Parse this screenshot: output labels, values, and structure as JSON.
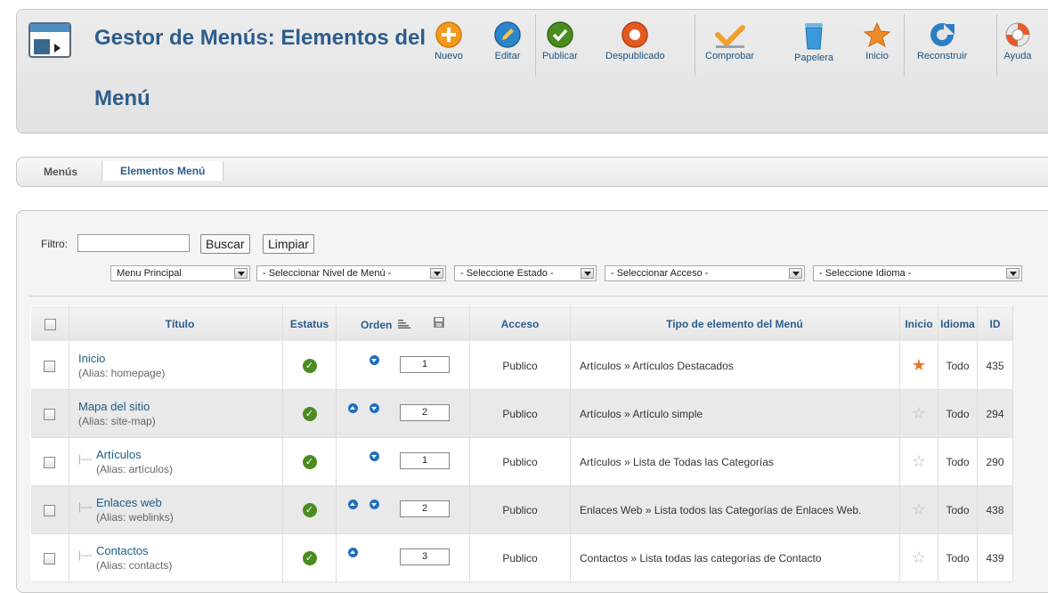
{
  "header": {
    "title": "Gestor de Menús: Elementos del Menú",
    "buttons": {
      "new": "Nuevo",
      "edit": "Editar",
      "publish": "Publicar",
      "unpublish": "Despublicado",
      "check": "Comprobar",
      "trash": "Papelera",
      "home": "Inicio",
      "rebuild": "Reconstruir",
      "help": "Ayuda"
    }
  },
  "submenu": {
    "menus": "Menús",
    "items": "Elementos Menú"
  },
  "filter": {
    "label": "Filtro:",
    "value": "",
    "search_button": "Buscar",
    "clear_button": "Limpiar",
    "selects": {
      "menu": "Menu Principal",
      "level": "- Seleccionar Nivel de Menú -",
      "state": "- Seleccione Estado -",
      "access": "- Seleccionar Acceso -",
      "language": "- Seleccione Idioma -"
    }
  },
  "table": {
    "headers": {
      "title": "Título",
      "status": "Estatus",
      "order": "Orden",
      "access": "Acceso",
      "type": "Tipo de elemento del Menú",
      "home": "Inicio",
      "language": "Idioma",
      "id": "ID"
    },
    "rows": [
      {
        "title": "Inicio",
        "alias": "(Alias: homepage)",
        "order": "1",
        "access": "Publico",
        "type": "Artículos » Artículos Destacados",
        "language": "Todo",
        "id": "435"
      },
      {
        "title": "Mapa del sitio",
        "alias": "(Alias: site-map)",
        "order": "2",
        "access": "Publico",
        "type": "Artículos » Artículo simple",
        "language": "Todo",
        "id": "294"
      },
      {
        "title": "Artículos",
        "alias": "(Alias: artículos)",
        "order": "1",
        "access": "Publico",
        "type": "Artículos » Lista de Todas las Categorías",
        "language": "Todo",
        "id": "290"
      },
      {
        "title": "Enlaces web",
        "alias": "(Alias: weblinks)",
        "order": "2",
        "access": "Publico",
        "type": "Enlaces Web » Lista todos las Categorías de Enlaces Web.",
        "language": "Todo",
        "id": "438"
      },
      {
        "title": "Contactos",
        "alias": "(Alias: contacts)",
        "order": "3",
        "access": "Publico",
        "type": "Contactos » Lista todas las categorías de Contacto",
        "language": "Todo",
        "id": "439"
      }
    ]
  },
  "colors": {
    "title": "#2c5d8c",
    "link": "#1c5c8a",
    "published": "#4b8c1f",
    "home_star": "#e8772a",
    "arrow": "#1f6fbf"
  }
}
